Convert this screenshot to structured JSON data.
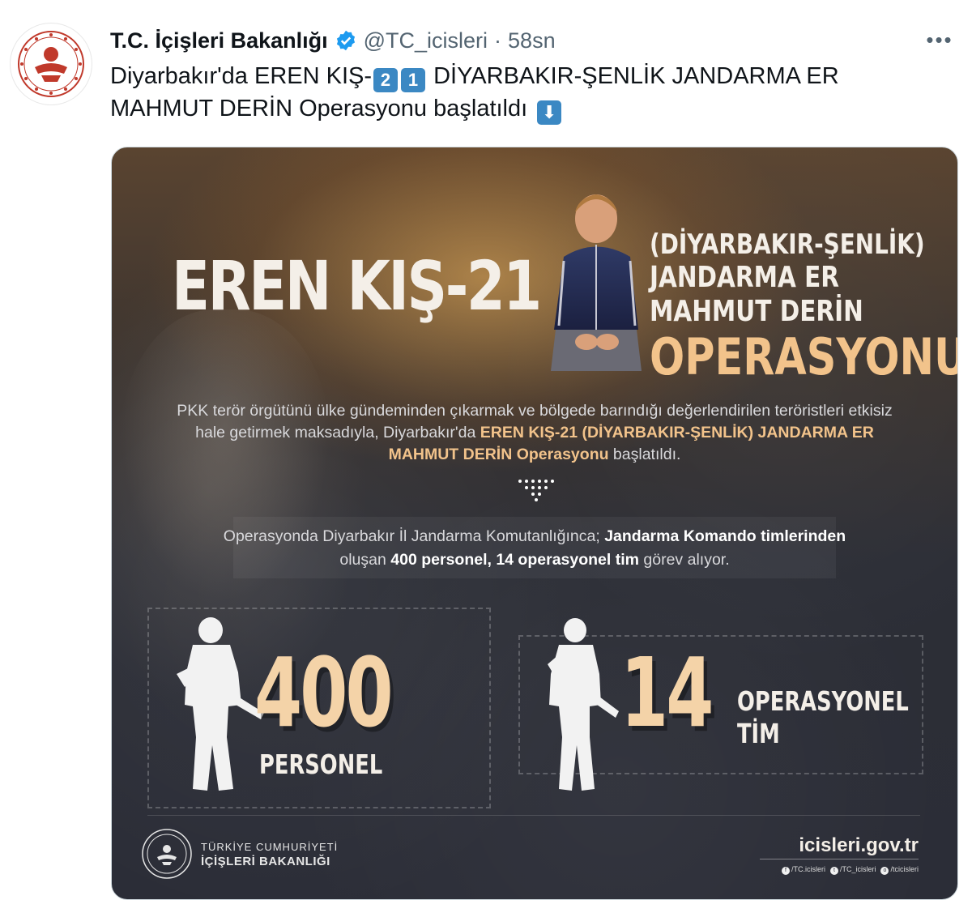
{
  "tweet": {
    "display_name": "T.C. İçişleri Bakanlığı",
    "handle": "@TC_icisleri",
    "separator": "·",
    "time": "58sn",
    "more_icon": "more-horizontal-icon",
    "text_part1": "Diyarbakır'da EREN KIŞ-",
    "keycap_1": "2",
    "keycap_2": "1",
    "text_part2": " DİYARBAKIR-ŞENLİK JANDARMA ER MAHMUT DERİN Operasyonu başlatıldı",
    "down_arrow": "⬇"
  },
  "infographic": {
    "title": "EREN KIŞ-21",
    "subtitle_line1": "(DİYARBAKIR-ŞENLİK)",
    "subtitle_line2": "JANDARMA ER",
    "subtitle_line3": "MAHMUT DERİN",
    "subtitle_line4": "OPERASYONU",
    "para_1": "PKK terör örgütünü ülke gündeminden çıkarmak ve bölgede barındığı değerlendirilen teröristleri etkisiz hale getirmek maksadıyla, Diyarbakır'da ",
    "para_bold1": "EREN KIŞ-21 (DİYARBAKIR-ŞENLİK) JANDARMA ER MAHMUT DERİN Operasyonu",
    "para_2": " başlatıldı.",
    "ops_1": "Operasyonda Diyarbakır İl Jandarma Komutanlığınca; ",
    "ops_bold1": "Jandarma Komando timlerinden",
    "ops_2": " oluşan ",
    "ops_bold2": "400 personel, 14 operasyonel tim",
    "ops_3": " görev alıyor.",
    "stat1_number": "400",
    "stat1_label": "PERSONEL",
    "stat2_number": "14",
    "stat2_label_line1": "OPERASYONEL",
    "stat2_label_line2": "TİM",
    "org_line1": "TÜRKİYE CUMHURİYETİ",
    "org_line2": "İÇİŞLERİ BAKANLIĞI",
    "website": "icisleri.gov.tr",
    "social_fb": "/TC.icisleri",
    "social_tw": "/TC_icisleri",
    "social_ig": "/tcicisleri"
  },
  "colors": {
    "accent_gold": "#f2c38b",
    "keycap_blue": "#3b88c3",
    "verified_blue": "#1d9bf0",
    "emblem_red": "#c0392b"
  }
}
